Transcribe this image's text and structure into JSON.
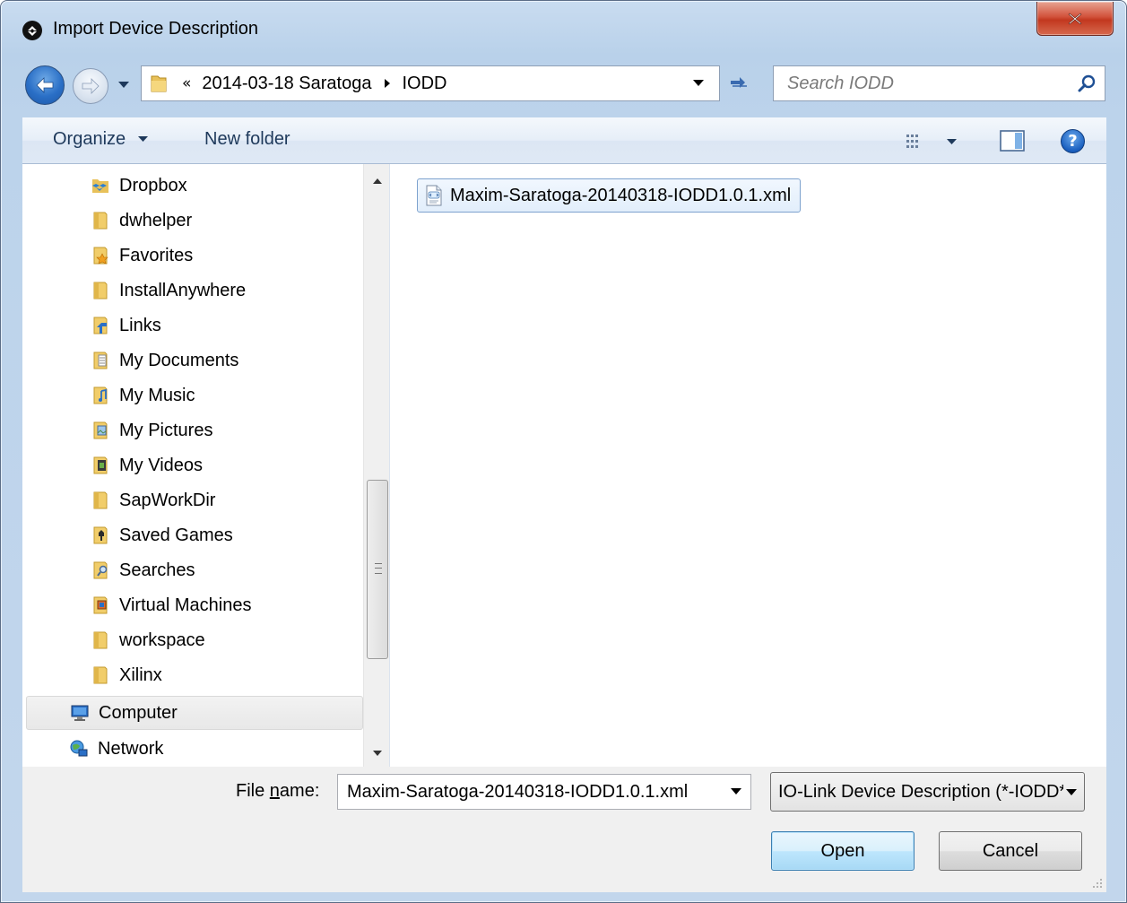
{
  "window": {
    "title": "Import Device Description",
    "close_label": "X"
  },
  "navigation": {
    "breadcrumb_lead": "«",
    "breadcrumbs": [
      "2014-03-18 Saratoga",
      "IODD"
    ]
  },
  "search": {
    "placeholder": "Search IODD"
  },
  "toolbar": {
    "organize_label": "Organize",
    "new_folder_label": "New folder",
    "help_label": "?"
  },
  "sidebar": {
    "items": [
      {
        "label": "Dropbox",
        "icon": "dropbox-icon"
      },
      {
        "label": "dwhelper",
        "icon": "folder-icon"
      },
      {
        "label": "Favorites",
        "icon": "favorites-folder-icon"
      },
      {
        "label": "InstallAnywhere",
        "icon": "folder-icon"
      },
      {
        "label": "Links",
        "icon": "links-folder-icon"
      },
      {
        "label": "My Documents",
        "icon": "documents-folder-icon"
      },
      {
        "label": "My Music",
        "icon": "music-folder-icon"
      },
      {
        "label": "My Pictures",
        "icon": "pictures-folder-icon"
      },
      {
        "label": "My Videos",
        "icon": "videos-folder-icon"
      },
      {
        "label": "SapWorkDir",
        "icon": "folder-icon"
      },
      {
        "label": "Saved Games",
        "icon": "saved-games-folder-icon"
      },
      {
        "label": "Searches",
        "icon": "searches-folder-icon"
      },
      {
        "label": "Virtual Machines",
        "icon": "vm-folder-icon"
      },
      {
        "label": "workspace",
        "icon": "folder-icon"
      },
      {
        "label": "Xilinx",
        "icon": "folder-icon"
      }
    ],
    "roots": [
      {
        "label": "Computer",
        "icon": "computer-icon"
      },
      {
        "label": "Network",
        "icon": "network-icon"
      }
    ]
  },
  "files": [
    {
      "name": "Maxim-Saratoga-20140318-IODD1.0.1.xml",
      "icon": "xml-file-icon"
    }
  ],
  "footer": {
    "file_name_label_pre": "File ",
    "file_name_label_underlined": "n",
    "file_name_label_post": "ame:",
    "file_name_value": "Maxim-Saratoga-20140318-IODD1.0.1.xml",
    "filter_value": "IO-Link Device Description (*-IODD*.xml)",
    "open_label": "Open",
    "cancel_label": "Cancel"
  },
  "colors": {
    "accent": "#3c7fb1",
    "frame": "#b9d1ea",
    "close": "#c2381f"
  }
}
